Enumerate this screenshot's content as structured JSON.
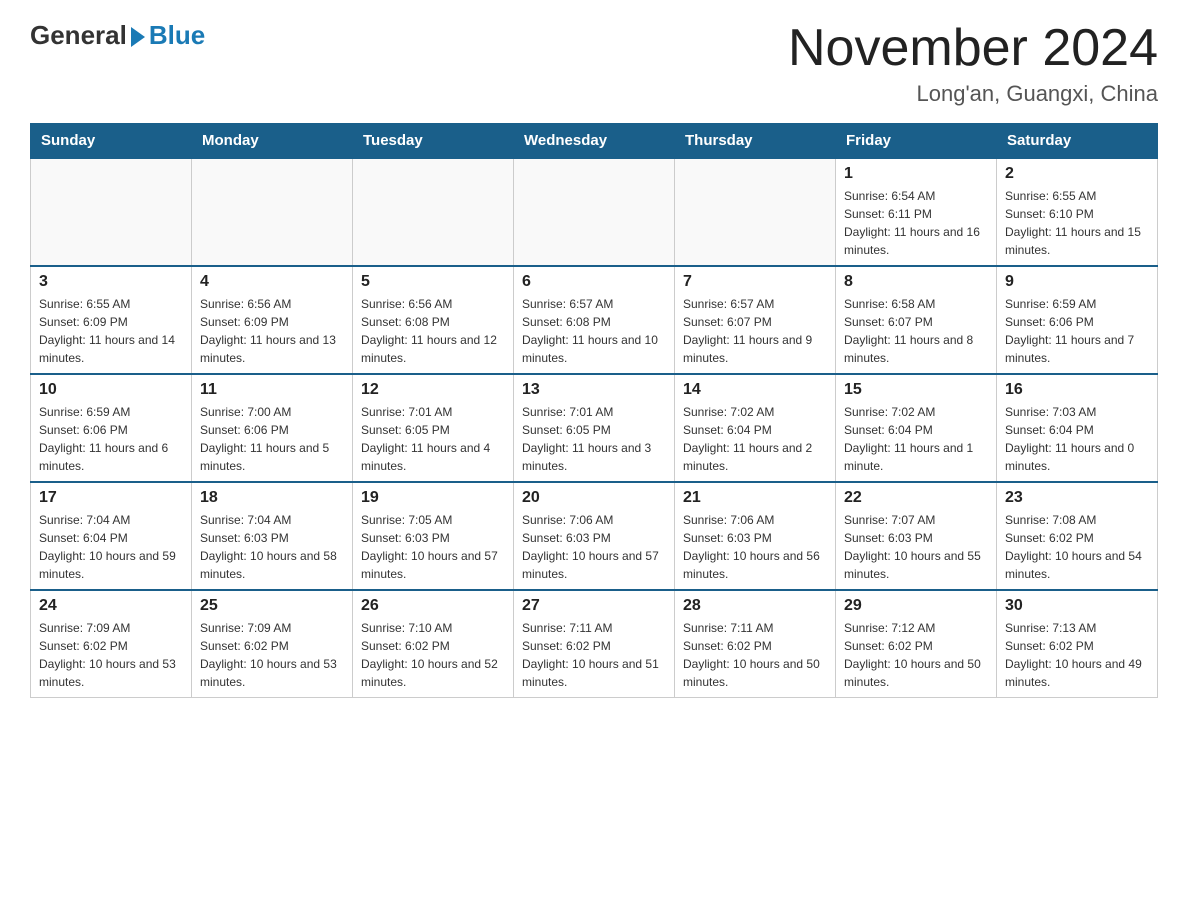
{
  "header": {
    "logo_general": "General",
    "logo_blue": "Blue",
    "month_title": "November 2024",
    "location": "Long'an, Guangxi, China"
  },
  "weekdays": [
    "Sunday",
    "Monday",
    "Tuesday",
    "Wednesday",
    "Thursday",
    "Friday",
    "Saturday"
  ],
  "weeks": [
    [
      {
        "day": "",
        "info": ""
      },
      {
        "day": "",
        "info": ""
      },
      {
        "day": "",
        "info": ""
      },
      {
        "day": "",
        "info": ""
      },
      {
        "day": "",
        "info": ""
      },
      {
        "day": "1",
        "info": "Sunrise: 6:54 AM\nSunset: 6:11 PM\nDaylight: 11 hours and 16 minutes."
      },
      {
        "day": "2",
        "info": "Sunrise: 6:55 AM\nSunset: 6:10 PM\nDaylight: 11 hours and 15 minutes."
      }
    ],
    [
      {
        "day": "3",
        "info": "Sunrise: 6:55 AM\nSunset: 6:09 PM\nDaylight: 11 hours and 14 minutes."
      },
      {
        "day": "4",
        "info": "Sunrise: 6:56 AM\nSunset: 6:09 PM\nDaylight: 11 hours and 13 minutes."
      },
      {
        "day": "5",
        "info": "Sunrise: 6:56 AM\nSunset: 6:08 PM\nDaylight: 11 hours and 12 minutes."
      },
      {
        "day": "6",
        "info": "Sunrise: 6:57 AM\nSunset: 6:08 PM\nDaylight: 11 hours and 10 minutes."
      },
      {
        "day": "7",
        "info": "Sunrise: 6:57 AM\nSunset: 6:07 PM\nDaylight: 11 hours and 9 minutes."
      },
      {
        "day": "8",
        "info": "Sunrise: 6:58 AM\nSunset: 6:07 PM\nDaylight: 11 hours and 8 minutes."
      },
      {
        "day": "9",
        "info": "Sunrise: 6:59 AM\nSunset: 6:06 PM\nDaylight: 11 hours and 7 minutes."
      }
    ],
    [
      {
        "day": "10",
        "info": "Sunrise: 6:59 AM\nSunset: 6:06 PM\nDaylight: 11 hours and 6 minutes."
      },
      {
        "day": "11",
        "info": "Sunrise: 7:00 AM\nSunset: 6:06 PM\nDaylight: 11 hours and 5 minutes."
      },
      {
        "day": "12",
        "info": "Sunrise: 7:01 AM\nSunset: 6:05 PM\nDaylight: 11 hours and 4 minutes."
      },
      {
        "day": "13",
        "info": "Sunrise: 7:01 AM\nSunset: 6:05 PM\nDaylight: 11 hours and 3 minutes."
      },
      {
        "day": "14",
        "info": "Sunrise: 7:02 AM\nSunset: 6:04 PM\nDaylight: 11 hours and 2 minutes."
      },
      {
        "day": "15",
        "info": "Sunrise: 7:02 AM\nSunset: 6:04 PM\nDaylight: 11 hours and 1 minute."
      },
      {
        "day": "16",
        "info": "Sunrise: 7:03 AM\nSunset: 6:04 PM\nDaylight: 11 hours and 0 minutes."
      }
    ],
    [
      {
        "day": "17",
        "info": "Sunrise: 7:04 AM\nSunset: 6:04 PM\nDaylight: 10 hours and 59 minutes."
      },
      {
        "day": "18",
        "info": "Sunrise: 7:04 AM\nSunset: 6:03 PM\nDaylight: 10 hours and 58 minutes."
      },
      {
        "day": "19",
        "info": "Sunrise: 7:05 AM\nSunset: 6:03 PM\nDaylight: 10 hours and 57 minutes."
      },
      {
        "day": "20",
        "info": "Sunrise: 7:06 AM\nSunset: 6:03 PM\nDaylight: 10 hours and 57 minutes."
      },
      {
        "day": "21",
        "info": "Sunrise: 7:06 AM\nSunset: 6:03 PM\nDaylight: 10 hours and 56 minutes."
      },
      {
        "day": "22",
        "info": "Sunrise: 7:07 AM\nSunset: 6:03 PM\nDaylight: 10 hours and 55 minutes."
      },
      {
        "day": "23",
        "info": "Sunrise: 7:08 AM\nSunset: 6:02 PM\nDaylight: 10 hours and 54 minutes."
      }
    ],
    [
      {
        "day": "24",
        "info": "Sunrise: 7:09 AM\nSunset: 6:02 PM\nDaylight: 10 hours and 53 minutes."
      },
      {
        "day": "25",
        "info": "Sunrise: 7:09 AM\nSunset: 6:02 PM\nDaylight: 10 hours and 53 minutes."
      },
      {
        "day": "26",
        "info": "Sunrise: 7:10 AM\nSunset: 6:02 PM\nDaylight: 10 hours and 52 minutes."
      },
      {
        "day": "27",
        "info": "Sunrise: 7:11 AM\nSunset: 6:02 PM\nDaylight: 10 hours and 51 minutes."
      },
      {
        "day": "28",
        "info": "Sunrise: 7:11 AM\nSunset: 6:02 PM\nDaylight: 10 hours and 50 minutes."
      },
      {
        "day": "29",
        "info": "Sunrise: 7:12 AM\nSunset: 6:02 PM\nDaylight: 10 hours and 50 minutes."
      },
      {
        "day": "30",
        "info": "Sunrise: 7:13 AM\nSunset: 6:02 PM\nDaylight: 10 hours and 49 minutes."
      }
    ]
  ]
}
